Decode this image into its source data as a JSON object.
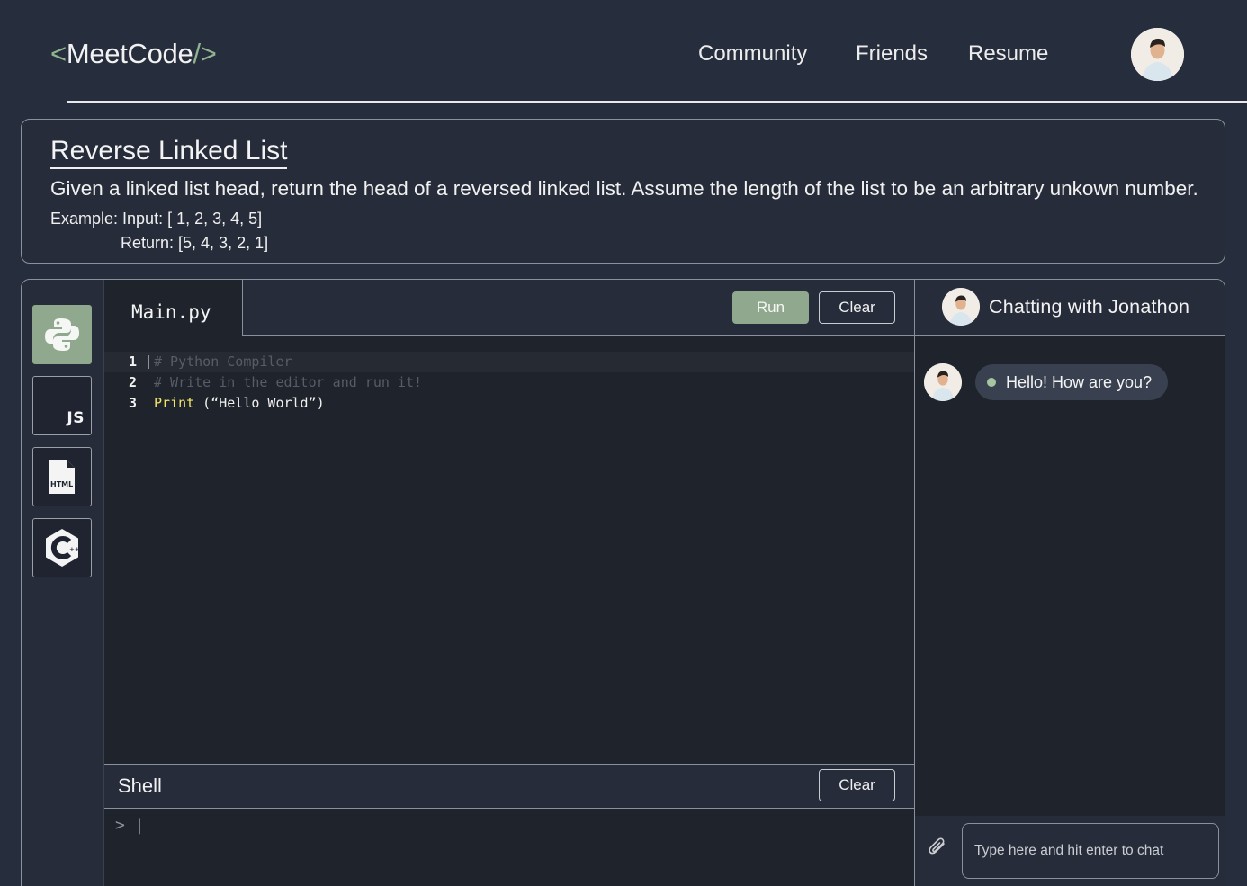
{
  "header": {
    "logo_open": "<",
    "logo_name": "MeetCode",
    "logo_close": "/>",
    "nav": [
      "Community",
      "Friends",
      "Resume"
    ]
  },
  "problem": {
    "title": "Reverse Linked List",
    "description": "Given a linked list head, return the head of a reversed linked list. Assume the length of the list to be an arbitrary unkown number.",
    "example_line": "Example: Input: [ 1, 2, 3, 4, 5]",
    "return_line": "Return: [5, 4, 3, 2, 1]"
  },
  "languages": [
    {
      "name": "python-icon",
      "active": true
    },
    {
      "name": "js-icon",
      "label": "JS",
      "active": false
    },
    {
      "name": "html-icon",
      "label": "HTML",
      "active": false
    },
    {
      "name": "cpp-icon",
      "active": false
    }
  ],
  "editor": {
    "file_name": "Main.py",
    "run_label": "Run",
    "clear_label": "Clear",
    "lines": [
      {
        "number": "1",
        "comment": "# Python Compiler"
      },
      {
        "number": "2",
        "comment": "# Write in the editor and run it!"
      },
      {
        "number": "3",
        "keyword": "Print",
        "code": " (“Hello World”)"
      }
    ]
  },
  "shell": {
    "title": "Shell",
    "clear_label": "Clear",
    "prompt": ">"
  },
  "chat": {
    "header": "Chatting with Jonathon",
    "messages": [
      {
        "text": "Hello! How are you?"
      }
    ],
    "input_placeholder": "Type here and hit enter to chat"
  },
  "colors": {
    "background": "#262d3c",
    "panel": "#1f232c",
    "accent_green": "#8fa88e",
    "keyword_yellow": "#f2e46a",
    "border": "#8b919c"
  }
}
